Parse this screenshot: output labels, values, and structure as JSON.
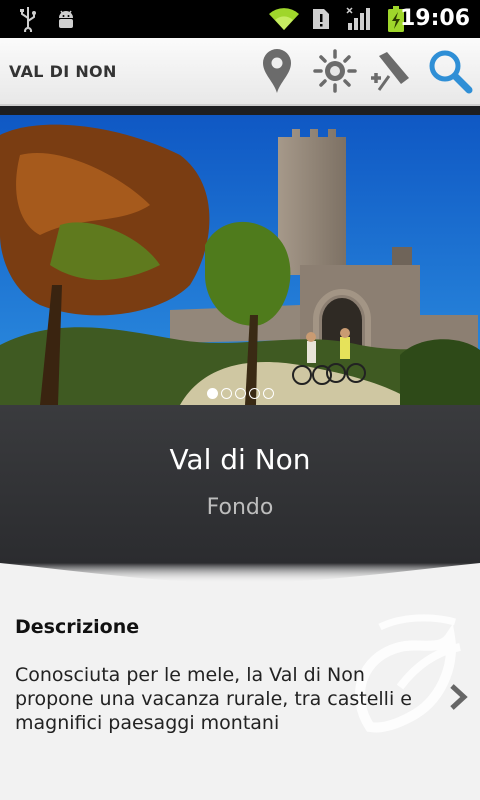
{
  "status_bar": {
    "time": "19:06",
    "icons": [
      "usb-icon",
      "android-debug-icon",
      "wifi-icon",
      "sim-alert-icon",
      "signal-icon",
      "battery-charging-icon"
    ]
  },
  "action_bar": {
    "title": "VAL DI NON",
    "actions": [
      "location-pin-icon",
      "weather-sun-icon",
      "pin-add-icon",
      "search-icon"
    ]
  },
  "gallery": {
    "page_count": 5,
    "current_page": 1
  },
  "place": {
    "name": "Val di Non",
    "subtitle": "Fondo"
  },
  "description": {
    "heading": "Descrizione",
    "text": "Conosciuta per le mele, la Val di Non propone una vacanza rurale, tra castelli e magnifici paesaggi montani"
  },
  "colors": {
    "accent_blue": "#2f8fd6",
    "panel_dark": "#2e2f32",
    "wifi_green": "#9fd62b"
  }
}
